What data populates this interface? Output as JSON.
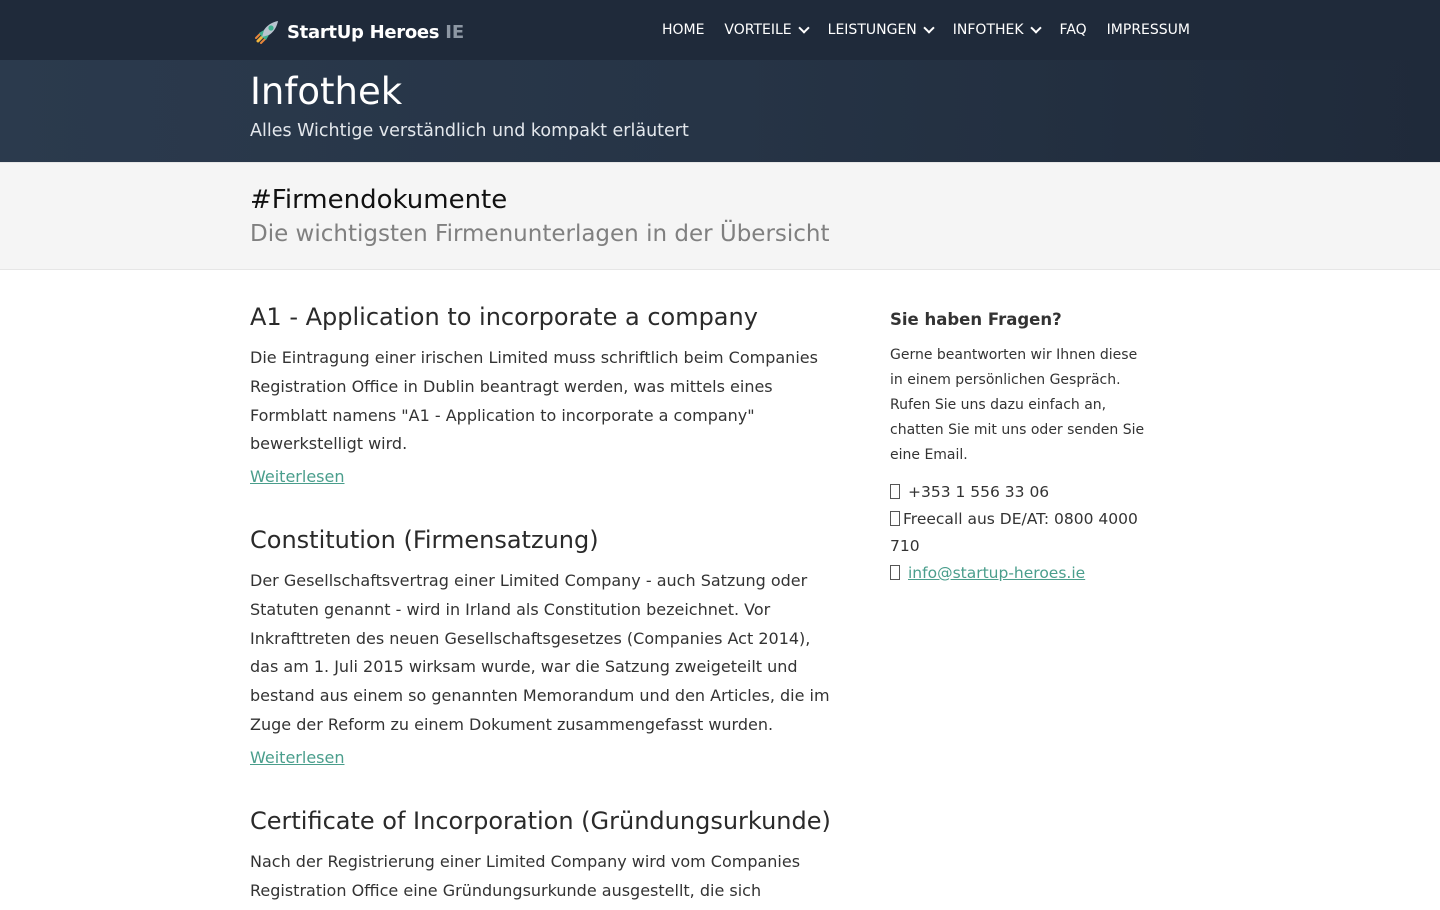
{
  "brand": {
    "name": "StartUp Heroes",
    "suffix": "IE",
    "icon": "rocket-icon"
  },
  "nav": {
    "items": [
      {
        "label": "HOME",
        "dropdown": false
      },
      {
        "label": "VORTEILE",
        "dropdown": true
      },
      {
        "label": "LEISTUNGEN",
        "dropdown": true
      },
      {
        "label": "INFOTHEK",
        "dropdown": true
      },
      {
        "label": "FAQ",
        "dropdown": false
      },
      {
        "label": "IMPRESSUM",
        "dropdown": false
      }
    ]
  },
  "page_header": {
    "title": "Infothek",
    "subtitle": "Alles Wichtige verständlich und kompakt erläutert"
  },
  "category": {
    "title": "#Firmendokumente",
    "subtitle": "Die wichtigsten Firmenunterlagen in der Übersicht"
  },
  "articles": [
    {
      "title": "A1 - Application to incorporate a company",
      "text": "Die Eintragung einer irischen Limited muss schriftlich beim Companies Registration Office in Dublin beantragt werden, was mittels eines Formblatt namens \"A1 - Application to incorporate a company\" bewerkstelligt wird.",
      "link": "Weiterlesen"
    },
    {
      "title": "Constitution (Firmensatzung)",
      "text": "Der Gesellschaftsvertrag einer Limited Company - auch Satzung oder Statuten genannt - wird in Irland als Constitution bezeichnet. Vor Inkrafttreten des neuen Gesellschaftsgesetzes (Companies Act 2014), das am 1. Juli 2015 wirksam wurde, war die Satzung zweigeteilt und bestand aus einem so genannten Memorandum und den Articles, die im Zuge der Reform zu einem Dokument zusammengefasst wurden.",
      "link": "Weiterlesen"
    },
    {
      "title": "Certificate of Incorporation (Gründungsurkunde)",
      "text": "Nach der Registrierung einer Limited Company wird vom Companies Registration Office eine Gründungsurkunde ausgestellt, die sich"
    }
  ],
  "sidebar": {
    "title": "Sie haben Fragen?",
    "text": "Gerne beantworten wir Ihnen diese in einem persönlichen Gespräch. Rufen Sie uns dazu einfach an, chatten Sie mit uns oder senden Sie eine Email.",
    "phone": "+353 1 556 33 06",
    "freecall": "Freecall aus DE/AT: 0800 4000 710",
    "email": "info@startup-heroes.ie",
    "icons": {
      "phone": "phone-icon",
      "freecall": "phone-icon",
      "email": "envelope-icon"
    }
  },
  "colors": {
    "navbar": "#1f2a3a",
    "header": "#263446",
    "banner": "#f5f5f5",
    "link": "#4a9e8c"
  }
}
